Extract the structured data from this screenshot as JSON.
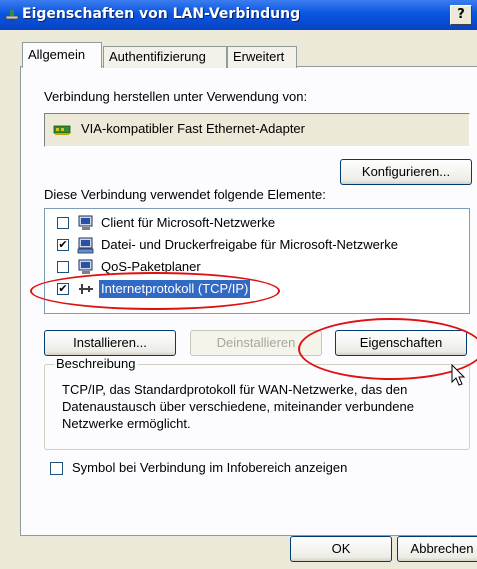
{
  "window": {
    "title": "Eigenschaften von LAN-Verbindung",
    "help_label": "?"
  },
  "tabs": [
    {
      "label": "Allgemein",
      "active": true
    },
    {
      "label": "Authentifizierung",
      "active": false
    },
    {
      "label": "Erweitert",
      "active": false
    }
  ],
  "general": {
    "connect_using_label": "Verbindung herstellen unter Verwendung von:",
    "adapter_name": "VIA-kompatibler Fast Ethernet-Adapter",
    "configure_button": "Konfigurieren...",
    "components_label": "Diese Verbindung verwendet folgende Elemente:",
    "components": [
      {
        "label": "Client für Microsoft-Netzwerke",
        "checked": false,
        "selected": false,
        "icon": "network-client-icon"
      },
      {
        "label": "Datei- und Druckerfreigabe für Microsoft-Netzwerke",
        "checked": true,
        "selected": false,
        "icon": "file-printer-share-icon"
      },
      {
        "label": "QoS-Paketplaner",
        "checked": false,
        "selected": false,
        "icon": "qos-scheduler-icon"
      },
      {
        "label": "Internetprotokoll (TCP/IP)",
        "checked": true,
        "selected": true,
        "icon": "protocol-icon"
      }
    ],
    "install_button": "Installieren...",
    "uninstall_button": "Deinstallieren",
    "properties_button": "Eigenschaften",
    "description_legend": "Beschreibung",
    "description_text": "TCP/IP, das Standardprotokoll für WAN-Netzwerke, das den Datenaustausch über verschiedene, miteinander verbundene Netzwerke ermöglicht.",
    "show_icon_label": "Symbol bei Verbindung im Infobereich anzeigen",
    "show_icon_checked": false
  },
  "footer": {
    "ok_button": "OK",
    "cancel_button": "Abbrechen"
  },
  "colors": {
    "titlebar": "#0a56e0",
    "selection": "#316ac5",
    "annotation": "#e01010"
  }
}
